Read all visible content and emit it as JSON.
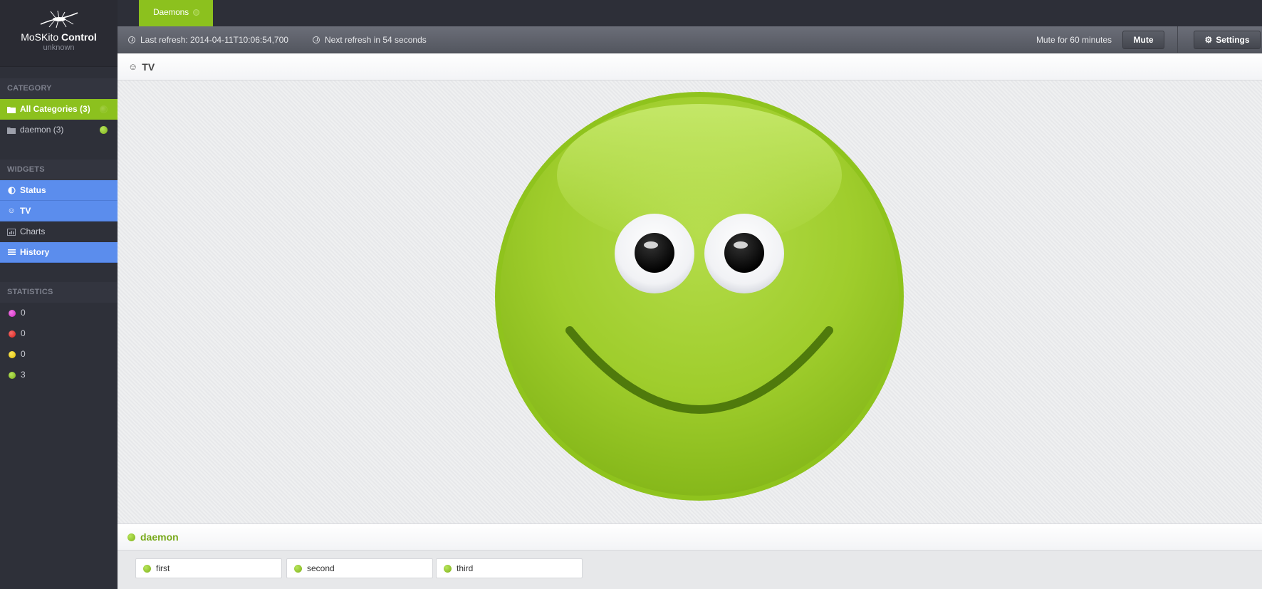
{
  "app": {
    "title_prefix": "MoSKito",
    "title_suffix": "Control",
    "subtitle": "unknown"
  },
  "top_tabs": [
    {
      "label": "Daemons"
    }
  ],
  "toolbar": {
    "last_refresh": "Last refresh: 2014-04-11T10:06:54,700",
    "next_refresh": "Next refresh in 54 seconds",
    "mute_label": "Mute for 60 minutes",
    "mute_button": "Mute",
    "settings_button": "Settings"
  },
  "sidebar": {
    "category_header": "CATEGORY",
    "categories": [
      {
        "label": "All Categories (3)",
        "icon": "folder-icon"
      },
      {
        "label": "daemon (3)",
        "icon": "folder-icon"
      }
    ],
    "widgets_header": "WIDGETS",
    "widgets": [
      {
        "label": "Status",
        "icon": "half-circle-icon"
      },
      {
        "label": "TV",
        "icon": "smiley-icon"
      },
      {
        "label": "Charts",
        "icon": "bar-chart-icon"
      },
      {
        "label": "History",
        "icon": "list-icon"
      }
    ],
    "statistics_header": "STATISTICS",
    "statistics": [
      {
        "count": "0",
        "color": "#e03ad2"
      },
      {
        "count": "0",
        "color": "#e8302c"
      },
      {
        "count": "0",
        "color": "#f2d50a"
      },
      {
        "count": "3",
        "color": "#86c21c"
      }
    ]
  },
  "tv": {
    "title": "TV",
    "status_color": "#9ccc2e"
  },
  "daemon": {
    "title": "daemon",
    "processes": [
      {
        "label": "first"
      },
      {
        "label": "second"
      },
      {
        "label": "third"
      }
    ]
  }
}
